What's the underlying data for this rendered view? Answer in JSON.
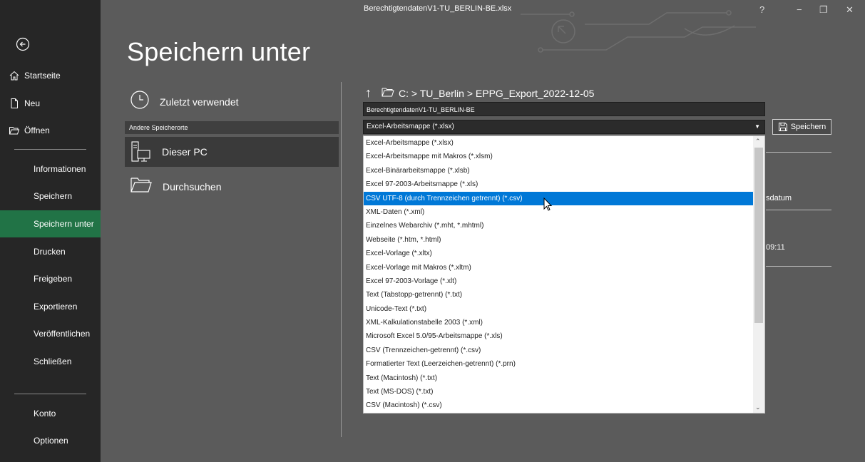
{
  "window": {
    "title": "BerechtigtendatenV1-TU_BERLIN-BE.xlsx",
    "help": "?",
    "minimize": "−",
    "restore": "❐",
    "close": "✕"
  },
  "sidebar": {
    "top_items": [
      {
        "label": "Startseite",
        "icon": "home-icon"
      },
      {
        "label": "Neu",
        "icon": "new-document-icon"
      },
      {
        "label": "Öffnen",
        "icon": "open-folder-icon"
      }
    ],
    "items": [
      {
        "label": "Informationen"
      },
      {
        "label": "Speichern"
      },
      {
        "label": "Speichern unter",
        "active": true
      },
      {
        "label": "Drucken"
      },
      {
        "label": "Freigeben"
      },
      {
        "label": "Exportieren"
      },
      {
        "label": "Veröffentlichen"
      },
      {
        "label": "Schließen"
      }
    ],
    "bottom_items": [
      {
        "label": "Konto"
      },
      {
        "label": "Optionen"
      }
    ]
  },
  "page": {
    "title": "Speichern unter"
  },
  "locations": {
    "recent": "Zuletzt verwendet",
    "other_header": "Andere Speicherorte",
    "this_pc": "Dieser PC",
    "browse": "Durchsuchen"
  },
  "path": {
    "text": "C: > TU_Berlin > EPPG_Export_2022-12-05"
  },
  "file": {
    "name": "BerechtigtendatenV1-TU_BERLIN-BE",
    "type_selected": "Excel-Arbeitsmappe (*.xlsx)",
    "save_label": "Speichern"
  },
  "right_column": {
    "header_partial": "sdatum",
    "time_partial": "09:11"
  },
  "dropdown": {
    "highlighted_index": 4,
    "options": [
      "Excel-Arbeitsmappe (*.xlsx)",
      "Excel-Arbeitsmappe mit Makros (*.xlsm)",
      "Excel-Binärarbeitsmappe (*.xlsb)",
      "Excel 97-2003-Arbeitsmappe (*.xls)",
      "CSV UTF-8 (durch Trennzeichen getrennt) (*.csv)",
      "XML-Daten (*.xml)",
      "Einzelnes Webarchiv (*.mht, *.mhtml)",
      "Webseite (*.htm, *.html)",
      "Excel-Vorlage (*.xltx)",
      "Excel-Vorlage mit Makros (*.xltm)",
      "Excel 97-2003-Vorlage (*.xlt)",
      "Text (Tabstopp-getrennt) (*.txt)",
      "Unicode-Text (*.txt)",
      "XML-Kalkulationstabelle 2003 (*.xml)",
      "Microsoft Excel 5.0/95-Arbeitsmappe (*.xls)",
      "CSV (Trennzeichen-getrennt) (*.csv)",
      "Formatierter Text (Leerzeichen-getrennt) (*.prn)",
      "Text (Macintosh) (*.txt)",
      "Text (MS-DOS) (*.txt)",
      "CSV (Macintosh) (*.csv)"
    ]
  },
  "colors": {
    "accent": "#217346",
    "highlight": "#0078d7",
    "sidebar": "#262626",
    "main": "#5b5b5b"
  }
}
